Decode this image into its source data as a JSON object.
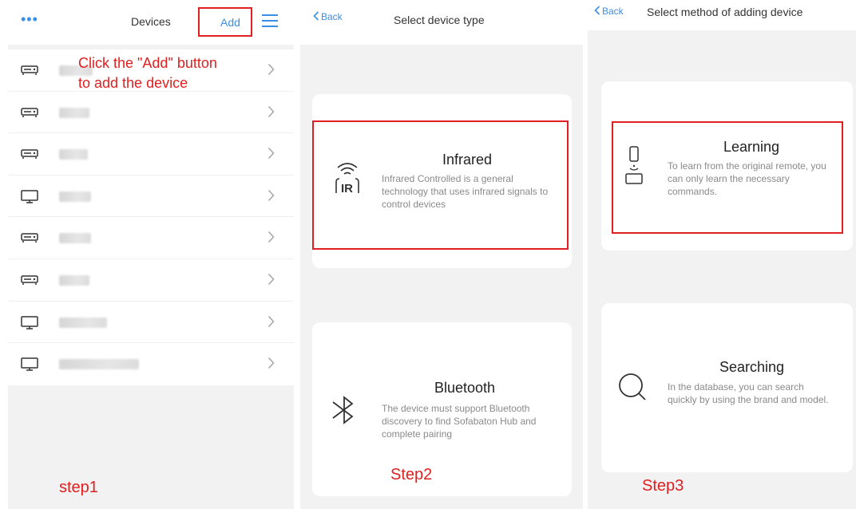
{
  "panel1": {
    "title": "Devices",
    "more_label": "•••",
    "add_label": "Add",
    "annotation_line1": "Click the \"Add\" button",
    "annotation_line2": "to add the device",
    "step_label": "step1",
    "devices": [
      {
        "icon": "settop-box-icon"
      },
      {
        "icon": "settop-box-icon"
      },
      {
        "icon": "settop-box-icon"
      },
      {
        "icon": "tv-icon"
      },
      {
        "icon": "settop-box-icon"
      },
      {
        "icon": "settop-box-icon"
      },
      {
        "icon": "tv-icon"
      },
      {
        "icon": "tv-icon"
      }
    ]
  },
  "panel2": {
    "back_label": "Back",
    "title": "Select device type",
    "infrared": {
      "title": "Infrared",
      "description": "Infrared Controlled is a  general technology that uses infrared signals to control devices",
      "icon_text": "IR"
    },
    "bluetooth": {
      "title": "Bluetooth",
      "description": "The device must support Bluetooth discovery to find Sofabaton Hub and complete pairing"
    },
    "step_label": "Step2"
  },
  "panel3": {
    "back_label": "Back",
    "title": "Select method of adding device",
    "learning": {
      "title": "Learning",
      "description": "To learn from the original remote, you can only learn the necessary commands."
    },
    "searching": {
      "title": "Searching",
      "description": "In the database, you can search quickly by using the brand and model."
    },
    "step_label": "Step3"
  },
  "colors": {
    "accent": "#3a8ee6",
    "annotation": "#e02020",
    "background": "#f2f2f2"
  }
}
